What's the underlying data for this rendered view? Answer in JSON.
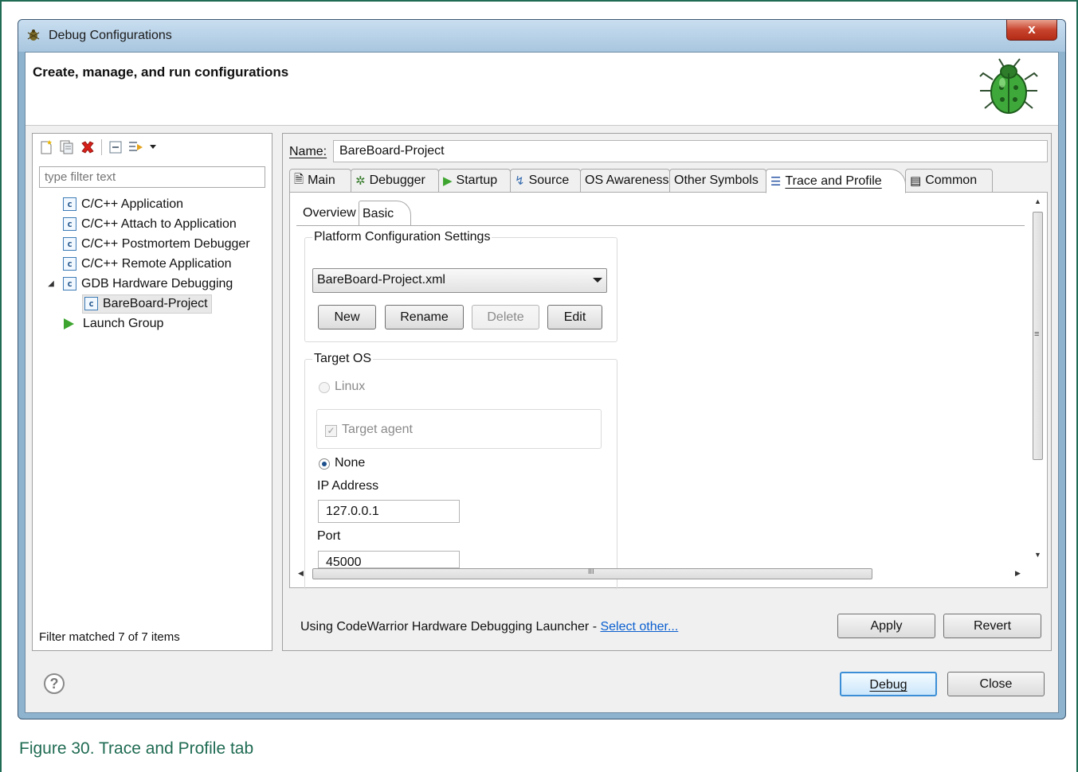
{
  "window": {
    "title": "Debug Configurations",
    "close_label": "x"
  },
  "header": {
    "title": "Create, manage, and run configurations"
  },
  "toolbar": {
    "icons": [
      "new-configuration-icon",
      "duplicate-icon",
      "delete-icon",
      "collapse-all-icon",
      "filter-icon"
    ]
  },
  "filter": {
    "placeholder": "type filter text"
  },
  "tree": {
    "items": [
      {
        "label": "C/C++ Application",
        "icon": "c"
      },
      {
        "label": "C/C++ Attach to Application",
        "icon": "c"
      },
      {
        "label": "C/C++ Postmortem Debugger",
        "icon": "c"
      },
      {
        "label": "C/C++ Remote Application",
        "icon": "c"
      },
      {
        "label": "GDB Hardware Debugging",
        "icon": "c"
      },
      {
        "label": "BareBoard-Project",
        "icon": "c"
      },
      {
        "label": "Launch Group",
        "icon": "launch"
      }
    ]
  },
  "filter_status": "Filter matched 7 of 7 items",
  "name": {
    "label": "Name:",
    "value": "BareBoard-Project"
  },
  "tabs": [
    "Main",
    "Debugger",
    "Startup",
    "Source",
    "OS Awareness",
    "Other Symbols",
    "Trace and Profile",
    "Common"
  ],
  "subtabs": [
    "Overview",
    "Basic"
  ],
  "platform": {
    "title": "Platform Configuration Settings",
    "selected": "BareBoard-Project.xml",
    "buttons": {
      "new": "New",
      "rename": "Rename",
      "delete": "Delete",
      "edit": "Edit"
    }
  },
  "target_os": {
    "title": "Target OS",
    "linux": "Linux",
    "target_agent": "Target agent",
    "none": "None",
    "ip_label": "IP Address",
    "ip_value": "127.0.0.1",
    "port_label": "Port",
    "port_value": "45000"
  },
  "launcher": {
    "text": "Using CodeWarrior Hardware Debugging Launcher - ",
    "link": "Select other..."
  },
  "actions": {
    "apply": "Apply",
    "revert": "Revert",
    "debug": "Debug",
    "close": "Close"
  },
  "scroll_grip": "III",
  "caption": "Figure 30.  Trace and Profile tab"
}
